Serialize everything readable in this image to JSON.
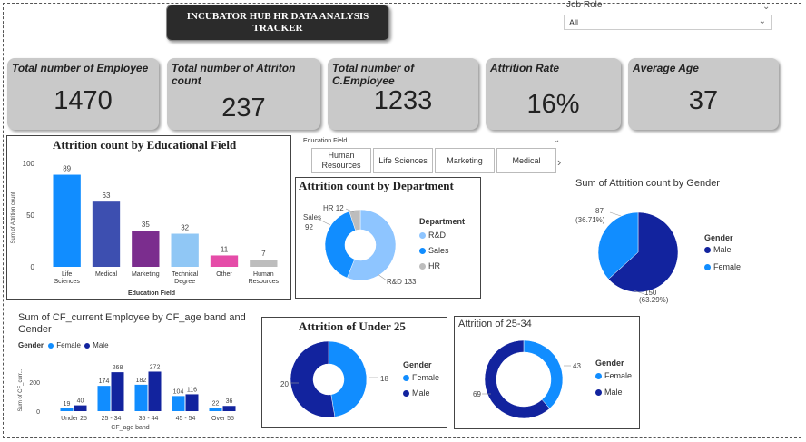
{
  "header": {
    "title_line1": "INCUBATOR HUB HR DATA ANALYSIS",
    "title_line2": "TRACKER"
  },
  "filter": {
    "label": "Job Role",
    "value": "All"
  },
  "kpis": [
    {
      "label": "Total number of Employee",
      "value": "1470"
    },
    {
      "label": "Total number of Attriton count",
      "value": "237"
    },
    {
      "label": "Total number of C.Employee",
      "value": "1233"
    },
    {
      "label": "Attrition Rate",
      "value": "16%"
    },
    {
      "label": "Average Age",
      "value": "37"
    }
  ],
  "edu_filter": {
    "label": "Education Field",
    "tabs": [
      "Human Resources",
      "Life Sciences",
      "Marketing",
      "Medical"
    ]
  },
  "colors": {
    "kpi_bg": "#c9c9c9",
    "dark_blue": "#12239e",
    "mid_blue": "#118dff",
    "light_blue": "#8ec5ff",
    "gray": "#bdbdbd"
  },
  "chart_data": [
    {
      "id": "edu",
      "type": "bar",
      "title": "Attrition count by Educational Field",
      "xlabel": "Education Field",
      "ylabel": "Sum of Attrition count",
      "ylim": [
        0,
        100
      ],
      "yticks": [
        0,
        50,
        100
      ],
      "categories": [
        "Life Sciences",
        "Medical",
        "Marketing",
        "Technical Degree",
        "Other",
        "Human Resources"
      ],
      "values": [
        89,
        63,
        35,
        32,
        11,
        7
      ],
      "colors": [
        "#118dff",
        "#3d4fb0",
        "#7b2d8e",
        "#90c7f5",
        "#e54ca8",
        "#bdbdbd"
      ]
    },
    {
      "id": "dept",
      "type": "pie",
      "title": "Attrition count by Department",
      "legend_title": "Department",
      "labels": [
        "R&D",
        "Sales",
        "HR"
      ],
      "values": [
        133,
        92,
        12
      ],
      "colors": [
        "#8ec5ff",
        "#118dff",
        "#bdbdbd"
      ]
    },
    {
      "id": "gender",
      "type": "pie",
      "title": "Sum of Attrition count by Gender",
      "legend_title": "Gender",
      "labels": [
        "Male",
        "Female"
      ],
      "values": [
        150,
        87
      ],
      "percent_labels": [
        "(63.29%)",
        "(36.71%)"
      ],
      "colors": [
        "#12239e",
        "#118dff"
      ]
    },
    {
      "id": "age",
      "type": "bar",
      "title": "Sum of CF_current Employee by CF_age band and Gender",
      "legend_title": "Gender",
      "xlabel": "CF_age band",
      "ylabel": "Sum of CF_curr...",
      "ylim": [
        0,
        300
      ],
      "yticks": [
        0,
        200
      ],
      "categories": [
        "Under 25",
        "25 - 34",
        "35 - 44",
        "45 - 54",
        "Over 55"
      ],
      "series": [
        {
          "name": "Female",
          "values": [
            19,
            174,
            182,
            104,
            22
          ],
          "color": "#118dff"
        },
        {
          "name": "Male",
          "values": [
            40,
            268,
            272,
            116,
            36
          ],
          "color": "#12239e"
        }
      ]
    },
    {
      "id": "under25",
      "type": "pie",
      "title": "Attrition of Under 25",
      "legend_title": "Gender",
      "labels": [
        "Female",
        "Male"
      ],
      "values": [
        18,
        20
      ],
      "colors": [
        "#118dff",
        "#12239e"
      ]
    },
    {
      "id": "age2534",
      "type": "pie",
      "title": "Attrition of 25-34",
      "legend_title": "Gender",
      "labels": [
        "Female",
        "Male"
      ],
      "values": [
        43,
        69
      ],
      "colors": [
        "#118dff",
        "#12239e"
      ]
    }
  ]
}
